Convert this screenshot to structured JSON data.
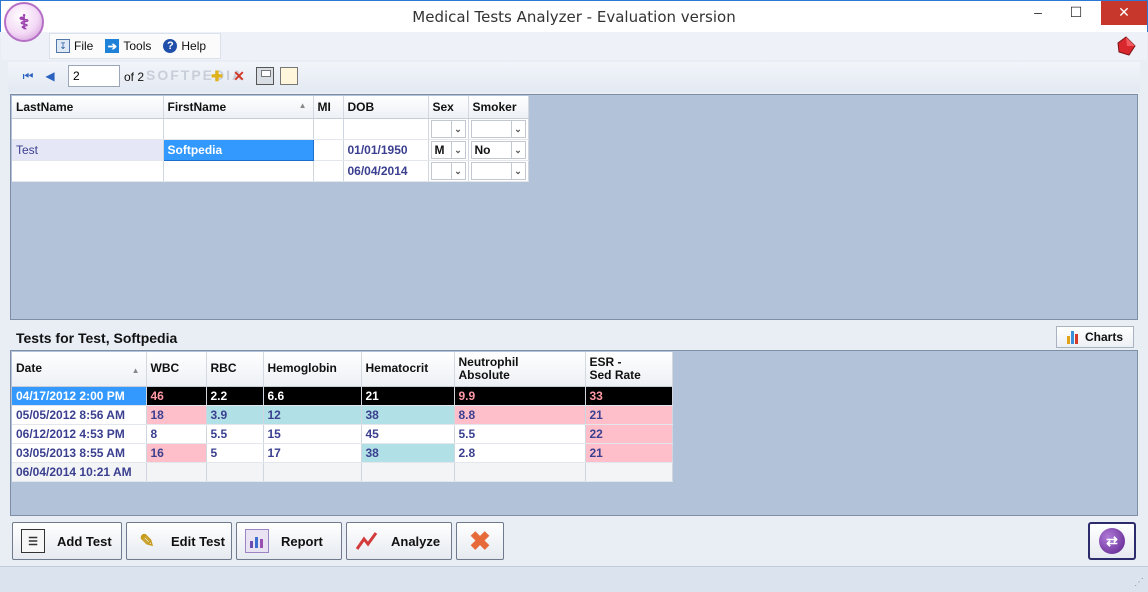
{
  "window": {
    "title": "Medical Tests Analyzer - Evaluation version",
    "minimize": "–",
    "maximize": "☐",
    "close": "✕"
  },
  "menu": {
    "file": "File",
    "tools": "Tools",
    "help": "Help"
  },
  "navigator": {
    "position": "2",
    "of_label": "of 2",
    "watermark": "SOFTPEDIA"
  },
  "patients": {
    "columns": [
      "LastName",
      "FirstName",
      "MI",
      "DOB",
      "Sex",
      "Smoker"
    ],
    "rows": [
      {
        "last": "",
        "first": "",
        "mi": "",
        "dob": "",
        "sex": "",
        "smoker": ""
      },
      {
        "last": "Test",
        "first": "Softpedia",
        "mi": "",
        "dob": "01/01/1950",
        "sex": "M",
        "smoker": "No"
      },
      {
        "last": "",
        "first": "",
        "mi": "",
        "dob": "06/04/2014",
        "sex": "",
        "smoker": ""
      }
    ]
  },
  "tests": {
    "title": "Tests for Test, Softpedia",
    "charts_label": "Charts",
    "columns": {
      "date": "Date",
      "wbc": "WBC",
      "rbc": "RBC",
      "hemoglobin": "Hemoglobin",
      "hematocrit": "Hematocrit",
      "neutrophil_1": "Neutrophil",
      "neutrophil_2": "Absolute",
      "esr_1": "ESR -",
      "esr_2": "Sed Rate"
    },
    "rows": [
      {
        "date": "04/17/2012 2:00 PM",
        "wbc": "46",
        "rbc": "2.2",
        "hemoglobin": "6.6",
        "hematocrit": "21",
        "neutrophil": "9.9",
        "esr": "33"
      },
      {
        "date": "05/05/2012 8:56 AM",
        "wbc": "18",
        "rbc": "3.9",
        "hemoglobin": "12",
        "hematocrit": "38",
        "neutrophil": "8.8",
        "esr": "21"
      },
      {
        "date": "06/12/2012 4:53 PM",
        "wbc": "8",
        "rbc": "5.5",
        "hemoglobin": "15",
        "hematocrit": "45",
        "neutrophil": "5.5",
        "esr": "22"
      },
      {
        "date": "03/05/2013 8:55 AM",
        "wbc": "16",
        "rbc": "5",
        "hemoglobin": "17",
        "hematocrit": "38",
        "neutrophil": "2.8",
        "esr": "21"
      },
      {
        "date": "06/04/2014 10:21 AM",
        "wbc": "",
        "rbc": "",
        "hemoglobin": "",
        "hematocrit": "",
        "neutrophil": "",
        "esr": ""
      }
    ]
  },
  "actions": {
    "add_test": "Add Test",
    "edit_test": "Edit Test",
    "report": "Report",
    "analyze": "Analyze"
  },
  "colors": {
    "grid_background": "#b1c2d9",
    "selection_blue": "#3399ff",
    "abnormal_high": "#ffbfca",
    "abnormal_low": "#b1e0e6",
    "text_value": "#3a3f8f"
  }
}
